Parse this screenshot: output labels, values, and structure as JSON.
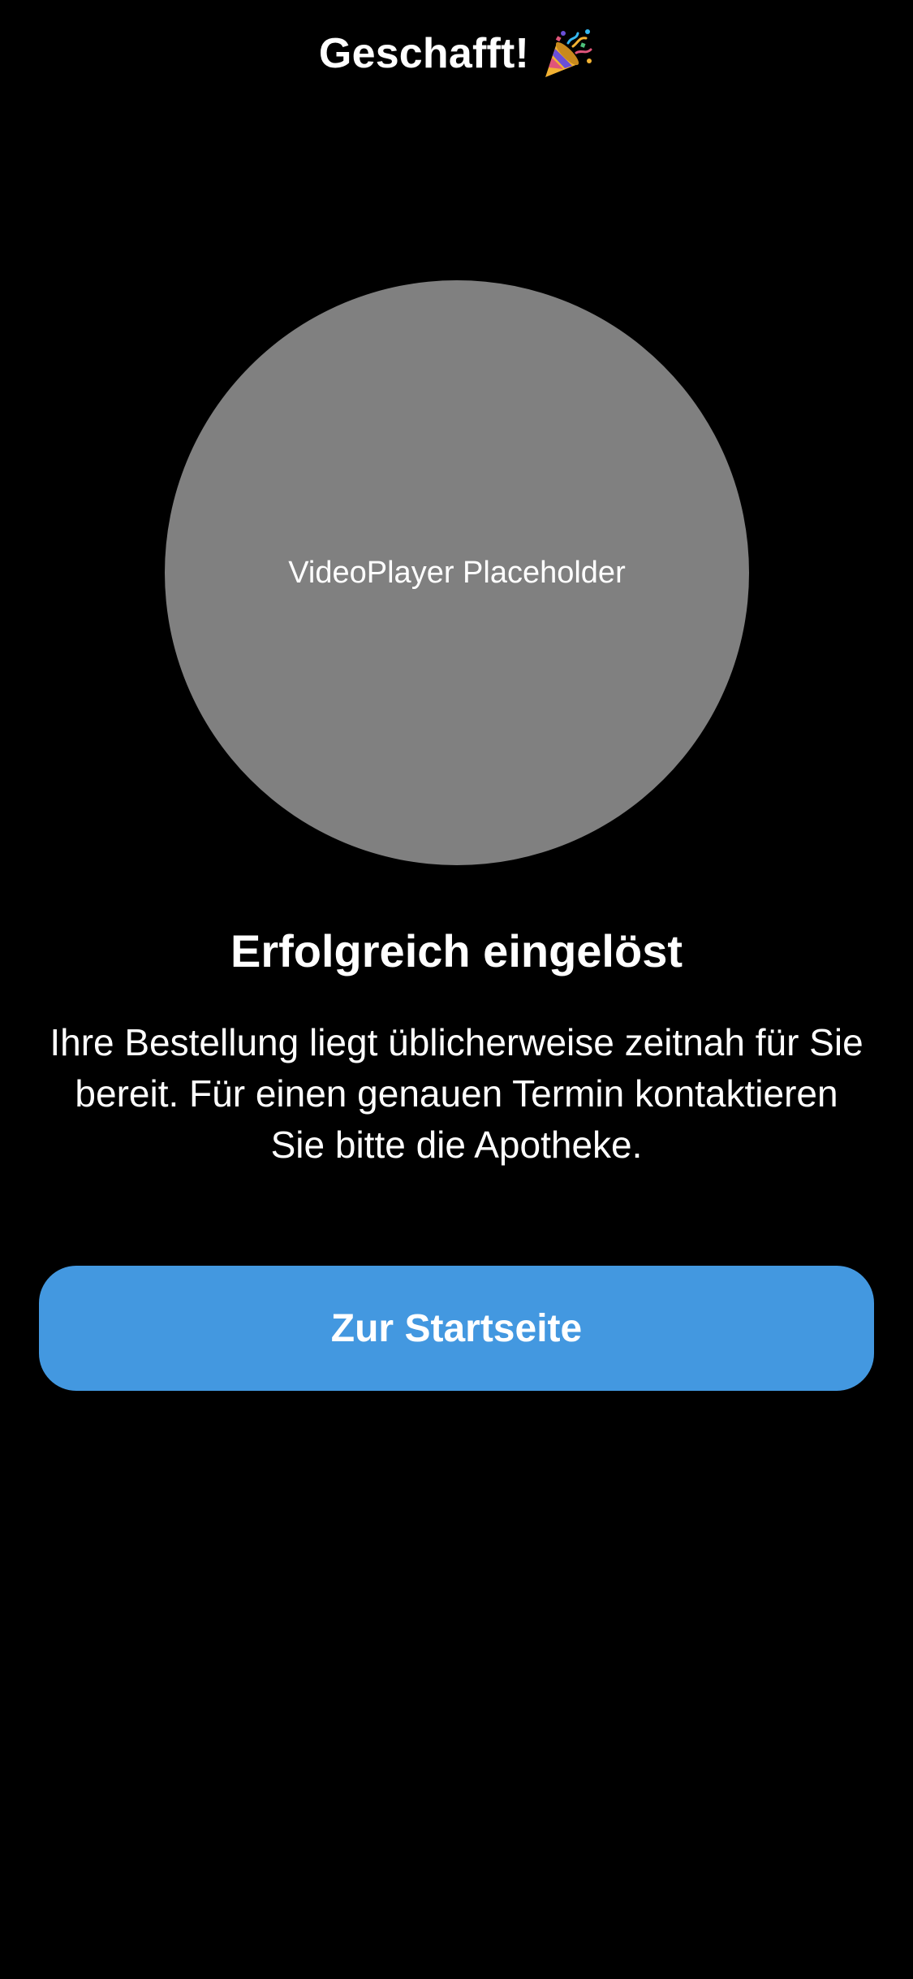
{
  "header": {
    "title": "Geschafft!",
    "title_icon": "party-popper-icon"
  },
  "video": {
    "placeholder_label": "VideoPlayer Placeholder"
  },
  "content": {
    "headline": "Erfolgreich eingelöst",
    "body": "Ihre Bestellung liegt üblicherweise zeitnah für Sie bereit. Für einen genauen Termin kontaktieren Sie bitte die Apotheke."
  },
  "actions": {
    "home_button_label": "Zur Startseite"
  },
  "colors": {
    "background": "#000000",
    "placeholder_circle": "#808080",
    "primary_button": "#4398E0",
    "text": "#FFFFFF"
  }
}
